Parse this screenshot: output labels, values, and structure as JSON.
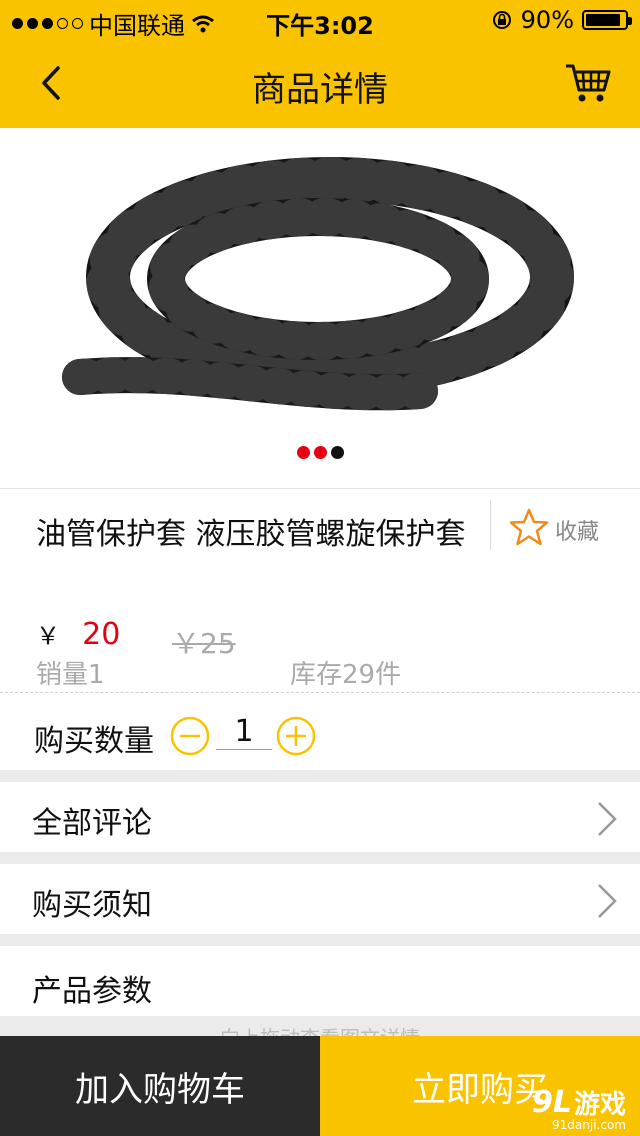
{
  "status": {
    "carrier": "中国联通",
    "time": "下午3:02",
    "battery": "90%",
    "battery_level": 0.9
  },
  "nav": {
    "title": "商品详情"
  },
  "product": {
    "title": "油管保护套 液压胶管螺旋保护套",
    "currency": "￥",
    "price": "20",
    "original_price": "￥25",
    "sales": "销量1",
    "stock": "库存29件",
    "favorite_label": "收藏"
  },
  "quantity": {
    "label": "购买数量",
    "value": "1"
  },
  "sections": {
    "reviews": "全部评论",
    "notice": "购买须知",
    "params": "产品参数"
  },
  "hint": "向上拖动查看图文详情",
  "bottom": {
    "add_to_cart": "加入购物车",
    "buy_now": "立即购买"
  },
  "watermark": {
    "logo": "9L",
    "text": "游戏",
    "site": "91danji.com"
  },
  "colors": {
    "brand_yellow": "#f9c300",
    "price_red": "#e60012",
    "dark": "#2b2b2b"
  }
}
